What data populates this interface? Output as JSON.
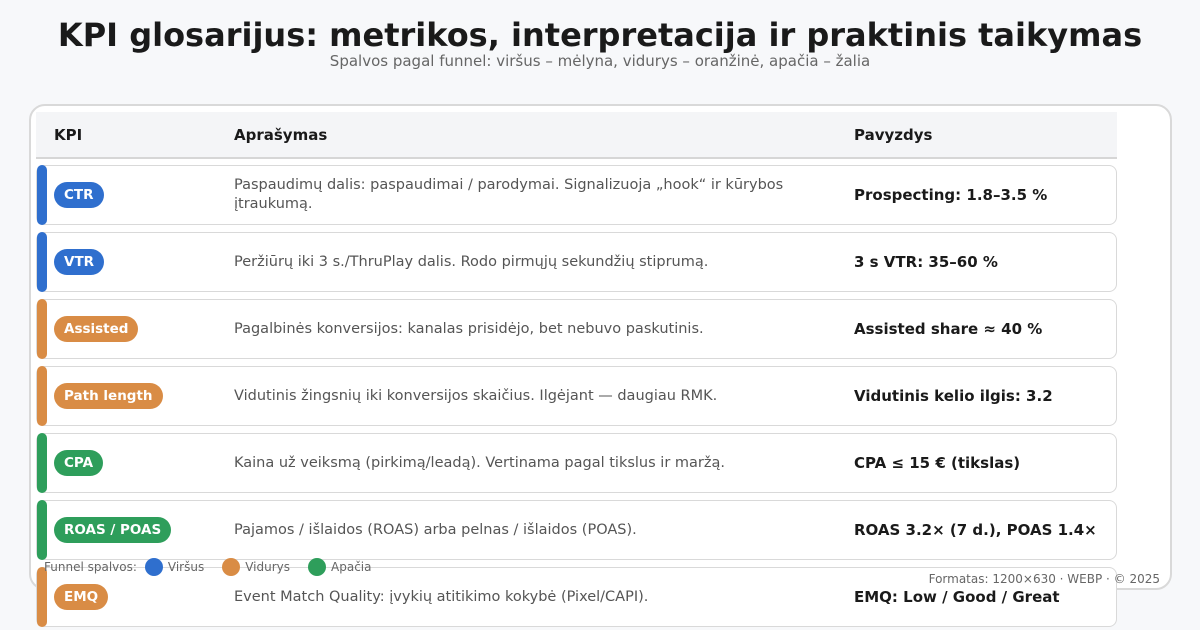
{
  "title": "KPI glosarijus: metrikos, interpretacija ir praktinis taikymas",
  "subtitle": "Spalvos pagal funnel: viršus – mėlyna, vidurys – oranžinė, apačia – žalia",
  "header": {
    "kpi": "KPI",
    "description": "Aprašymas",
    "example": "Pavyzdys"
  },
  "colors": {
    "top": "#2f6fce",
    "middle": "#d98c45",
    "bottom": "#2e9e5b"
  },
  "rows": [
    {
      "kpi": "CTR",
      "stage": "top",
      "description": "Paspaudimų dalis: paspaudimai / parodymai. Signalizuoja „hook“ ir kūrybos įtraukumą.",
      "example": "Prospecting: 1.8–3.5 %"
    },
    {
      "kpi": "VTR",
      "stage": "top",
      "description": "Peržiūrų iki 3 s./ThruPlay dalis. Rodo pirmųjų sekundžių stiprumą.",
      "example": "3 s VTR: 35–60 %"
    },
    {
      "kpi": "Assisted",
      "stage": "middle",
      "description": "Pagalbinės konversijos: kanalas prisidėjo, bet nebuvo paskutinis.",
      "example": "Assisted share ≈ 40 %"
    },
    {
      "kpi": "Path length",
      "stage": "middle",
      "description": "Vidutinis žingsnių iki konversijos skaičius. Ilgėjant — daugiau RMK.",
      "example": "Vidutinis kelio ilgis: 3.2"
    },
    {
      "kpi": "CPA",
      "stage": "bottom",
      "description": "Kaina už veiksmą (pirkimą/leadą). Vertinama pagal tikslus ir maržą.",
      "example": "CPA ≤ 15 € (tikslas)"
    },
    {
      "kpi": "ROAS / POAS",
      "stage": "bottom",
      "description": "Pajamos / išlaidos (ROAS) arba pelnas / išlaidos (POAS).",
      "example": "ROAS 3.2× (7 d.), POAS 1.4×"
    },
    {
      "kpi": "EMQ",
      "stage": "middle",
      "description": "Event Match Quality: įvykių atitikimo kokybė (Pixel/CAPI).",
      "example": "EMQ: Low / Good / Great"
    }
  ],
  "legend": {
    "label": "Funnel spalvos:",
    "items": [
      {
        "label": "Viršus",
        "stage": "top"
      },
      {
        "label": "Vidurys",
        "stage": "middle"
      },
      {
        "label": "Apačia",
        "stage": "bottom"
      }
    ]
  },
  "footer": "Formatas: 1200×630 · WEBP · © 2025"
}
